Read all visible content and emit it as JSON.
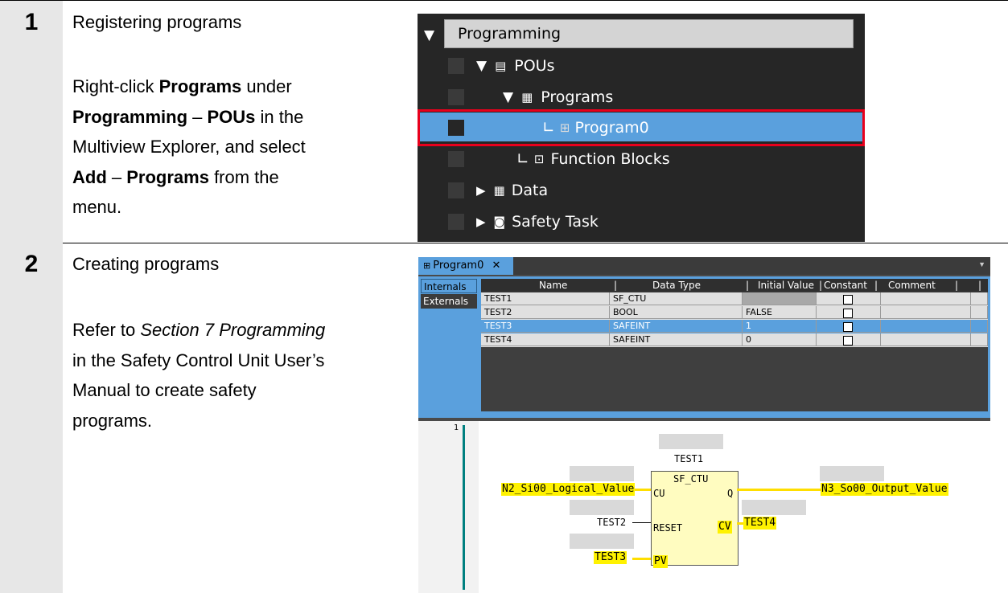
{
  "steps": [
    {
      "number": "1",
      "title": "Registering programs",
      "body": {
        "p1": "Right-click ",
        "b1": "Programs",
        "p2": " under",
        "b2": "Programming",
        "p3": " – ",
        "b3": "POUs",
        "p4": " in the",
        "line3": "Multiview Explorer, and select",
        "b4": "Add",
        "p5": " – ",
        "b5": "Programs",
        "p6": " from the",
        "line5": "menu."
      }
    },
    {
      "number": "2",
      "title": "Creating programs",
      "body": {
        "p1": "Refer to ",
        "i1": "Section 7 Programming",
        "line2": "in the Safety Control Unit User’s",
        "line3": "Manual to create safety",
        "line4": "programs."
      }
    }
  ],
  "explorer": {
    "items": [
      "Programming",
      "POUs",
      "Programs",
      "Program0",
      "Function Blocks",
      "Data",
      "Safety Task"
    ],
    "selected_item": "Program0",
    "highlight_color": "#e8001c"
  },
  "editor": {
    "tab_label": "Program0",
    "side_tabs": [
      "Internals",
      "Externals"
    ],
    "columns": [
      "Name",
      "Data Type",
      "Initial Value",
      "Constant",
      "Comment"
    ],
    "rows": [
      {
        "name": "TEST1",
        "type": "SF_CTU",
        "initial": ""
      },
      {
        "name": "TEST2",
        "type": "BOOL",
        "initial": "FALSE"
      },
      {
        "name": "TEST3",
        "type": "SAFEINT",
        "initial": "1"
      },
      {
        "name": "TEST4",
        "type": "SAFEINT",
        "initial": "0"
      }
    ],
    "selected_row": "TEST3",
    "ladder": {
      "line_number": "1",
      "fb_instance": "TEST1",
      "fb_type": "SF_CTU",
      "pins": {
        "cu": "CU",
        "reset": "RESET",
        "pv": "PV",
        "q": "Q",
        "cv": "CV"
      },
      "inputs": {
        "cu": "N2_Si00_Logical_Value",
        "reset": "TEST2",
        "pv": "TEST3"
      },
      "outputs": {
        "q": "N3_So00_Output_Value",
        "cv": "TEST4"
      }
    }
  }
}
